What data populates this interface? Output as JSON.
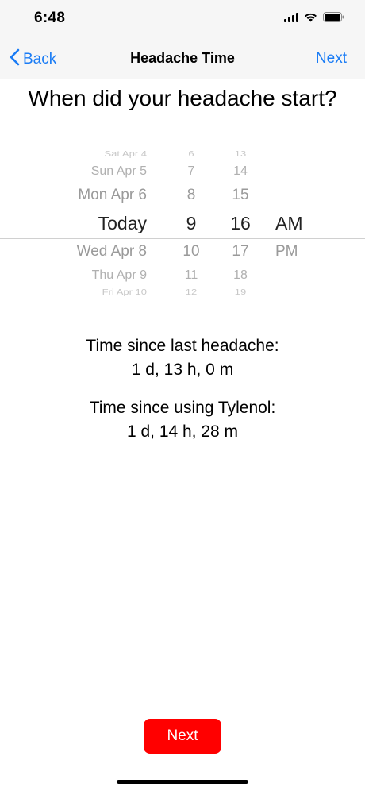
{
  "status_bar": {
    "time": "6:48"
  },
  "nav": {
    "back_label": "Back",
    "title": "Headache Time",
    "next_label": "Next"
  },
  "question": "When did your headache start?",
  "picker": {
    "dates": [
      "Sat Apr 4",
      "Sun Apr 5",
      "Mon Apr 6",
      "Today",
      "Wed Apr 8",
      "Thu Apr 9",
      "Fri Apr 10"
    ],
    "hours": [
      "6",
      "7",
      "8",
      "9",
      "10",
      "11",
      "12"
    ],
    "minutes": [
      "13",
      "14",
      "15",
      "16",
      "17",
      "18",
      "19"
    ],
    "ampm": [
      "AM",
      "PM"
    ],
    "selected": {
      "date": "Today",
      "hour": "9",
      "minute": "16",
      "ampm": "AM"
    }
  },
  "info": {
    "last_headache_label": "Time since last headache:",
    "last_headache_value": "1 d, 13 h, 0 m",
    "tylenol_label": "Time since using Tylenol:",
    "tylenol_value": "1 d, 14 h, 28 m"
  },
  "footer": {
    "next_button": "Next"
  },
  "colors": {
    "accent": "#1a7cf5",
    "next_button": "#ff0000"
  }
}
